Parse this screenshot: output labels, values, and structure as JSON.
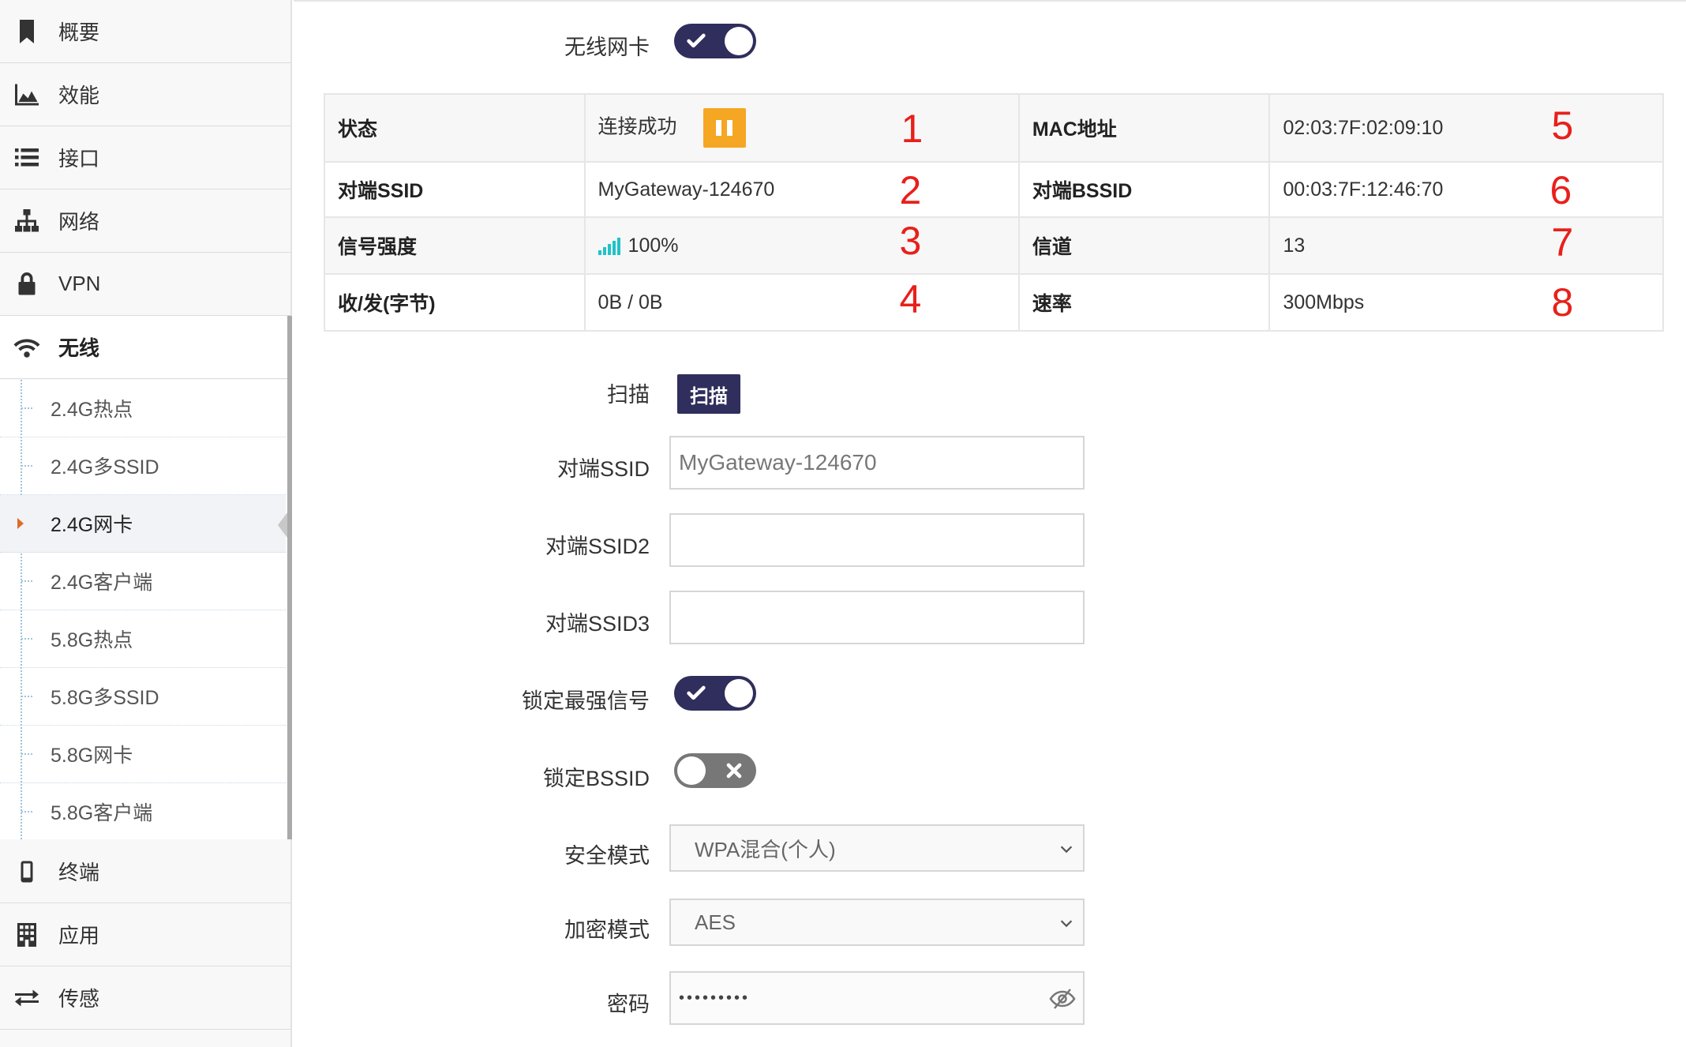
{
  "sidebar": {
    "items": [
      {
        "key": "overview",
        "label": "概要",
        "icon": "bookmark-icon"
      },
      {
        "key": "performance",
        "label": "效能",
        "icon": "area-chart-icon"
      },
      {
        "key": "interface",
        "label": "接口",
        "icon": "list-icon"
      },
      {
        "key": "network",
        "label": "网络",
        "icon": "sitemap-icon"
      },
      {
        "key": "vpn",
        "label": "VPN",
        "icon": "lock-icon"
      },
      {
        "key": "wireless",
        "label": "无线",
        "icon": "wifi-icon",
        "active": true
      }
    ],
    "submenu": [
      {
        "label": "2.4G热点"
      },
      {
        "label": "2.4G多SSID"
      },
      {
        "label": "2.4G网卡",
        "active": true
      },
      {
        "label": "2.4G客户端"
      },
      {
        "label": "5.8G热点"
      },
      {
        "label": "5.8G多SSID"
      },
      {
        "label": "5.8G网卡"
      },
      {
        "label": "5.8G客户端"
      }
    ],
    "bottom_items": [
      {
        "key": "terminal",
        "label": "终端",
        "icon": "mobile-icon"
      },
      {
        "key": "app",
        "label": "应用",
        "icon": "building-icon"
      },
      {
        "key": "sensor",
        "label": "传感",
        "icon": "exchange-icon"
      }
    ]
  },
  "form": {
    "wireless_card": {
      "label": "无线网卡",
      "enabled": true
    },
    "scan": {
      "label": "扫描",
      "button": "扫描"
    },
    "peer_ssid": {
      "label": "对端SSID",
      "value": "MyGateway-124670"
    },
    "peer_ssid2": {
      "label": "对端SSID2",
      "value": ""
    },
    "peer_ssid3": {
      "label": "对端SSID3",
      "value": ""
    },
    "lock_strongest": {
      "label": "锁定最强信号",
      "enabled": true
    },
    "lock_bssid": {
      "label": "锁定BSSID",
      "enabled": false
    },
    "security_mode": {
      "label": "安全模式",
      "value": "WPA混合(个人)"
    },
    "encryption_mode": {
      "label": "加密模式",
      "value": "AES"
    },
    "password": {
      "label": "密码",
      "value": "•••••••••"
    }
  },
  "status_table": {
    "rows": [
      {
        "k1": "状态",
        "v1": "连接成功",
        "n1": "1",
        "k2": "MAC地址",
        "v2": "02:03:7F:02:09:10",
        "n2": "5"
      },
      {
        "k1": "对端SSID",
        "v1": "MyGateway-124670",
        "n1": "2",
        "k2": "对端BSSID",
        "v2": "00:03:7F:12:46:70",
        "n2": "6"
      },
      {
        "k1": "信号强度",
        "v1": "100%",
        "n1": "3",
        "k2": "信道",
        "v2": "13",
        "n2": "7"
      },
      {
        "k1": "收/发(字节)",
        "v1": "0B / 0B",
        "n1": "4",
        "k2": "速率",
        "v2": "300Mbps",
        "n2": "8"
      }
    ],
    "signal_strength": 1.0
  },
  "colors": {
    "accent": "#2f2e5c",
    "pause": "#f5a623",
    "annotation": "#e8201a",
    "signal": "#20c2c9"
  }
}
